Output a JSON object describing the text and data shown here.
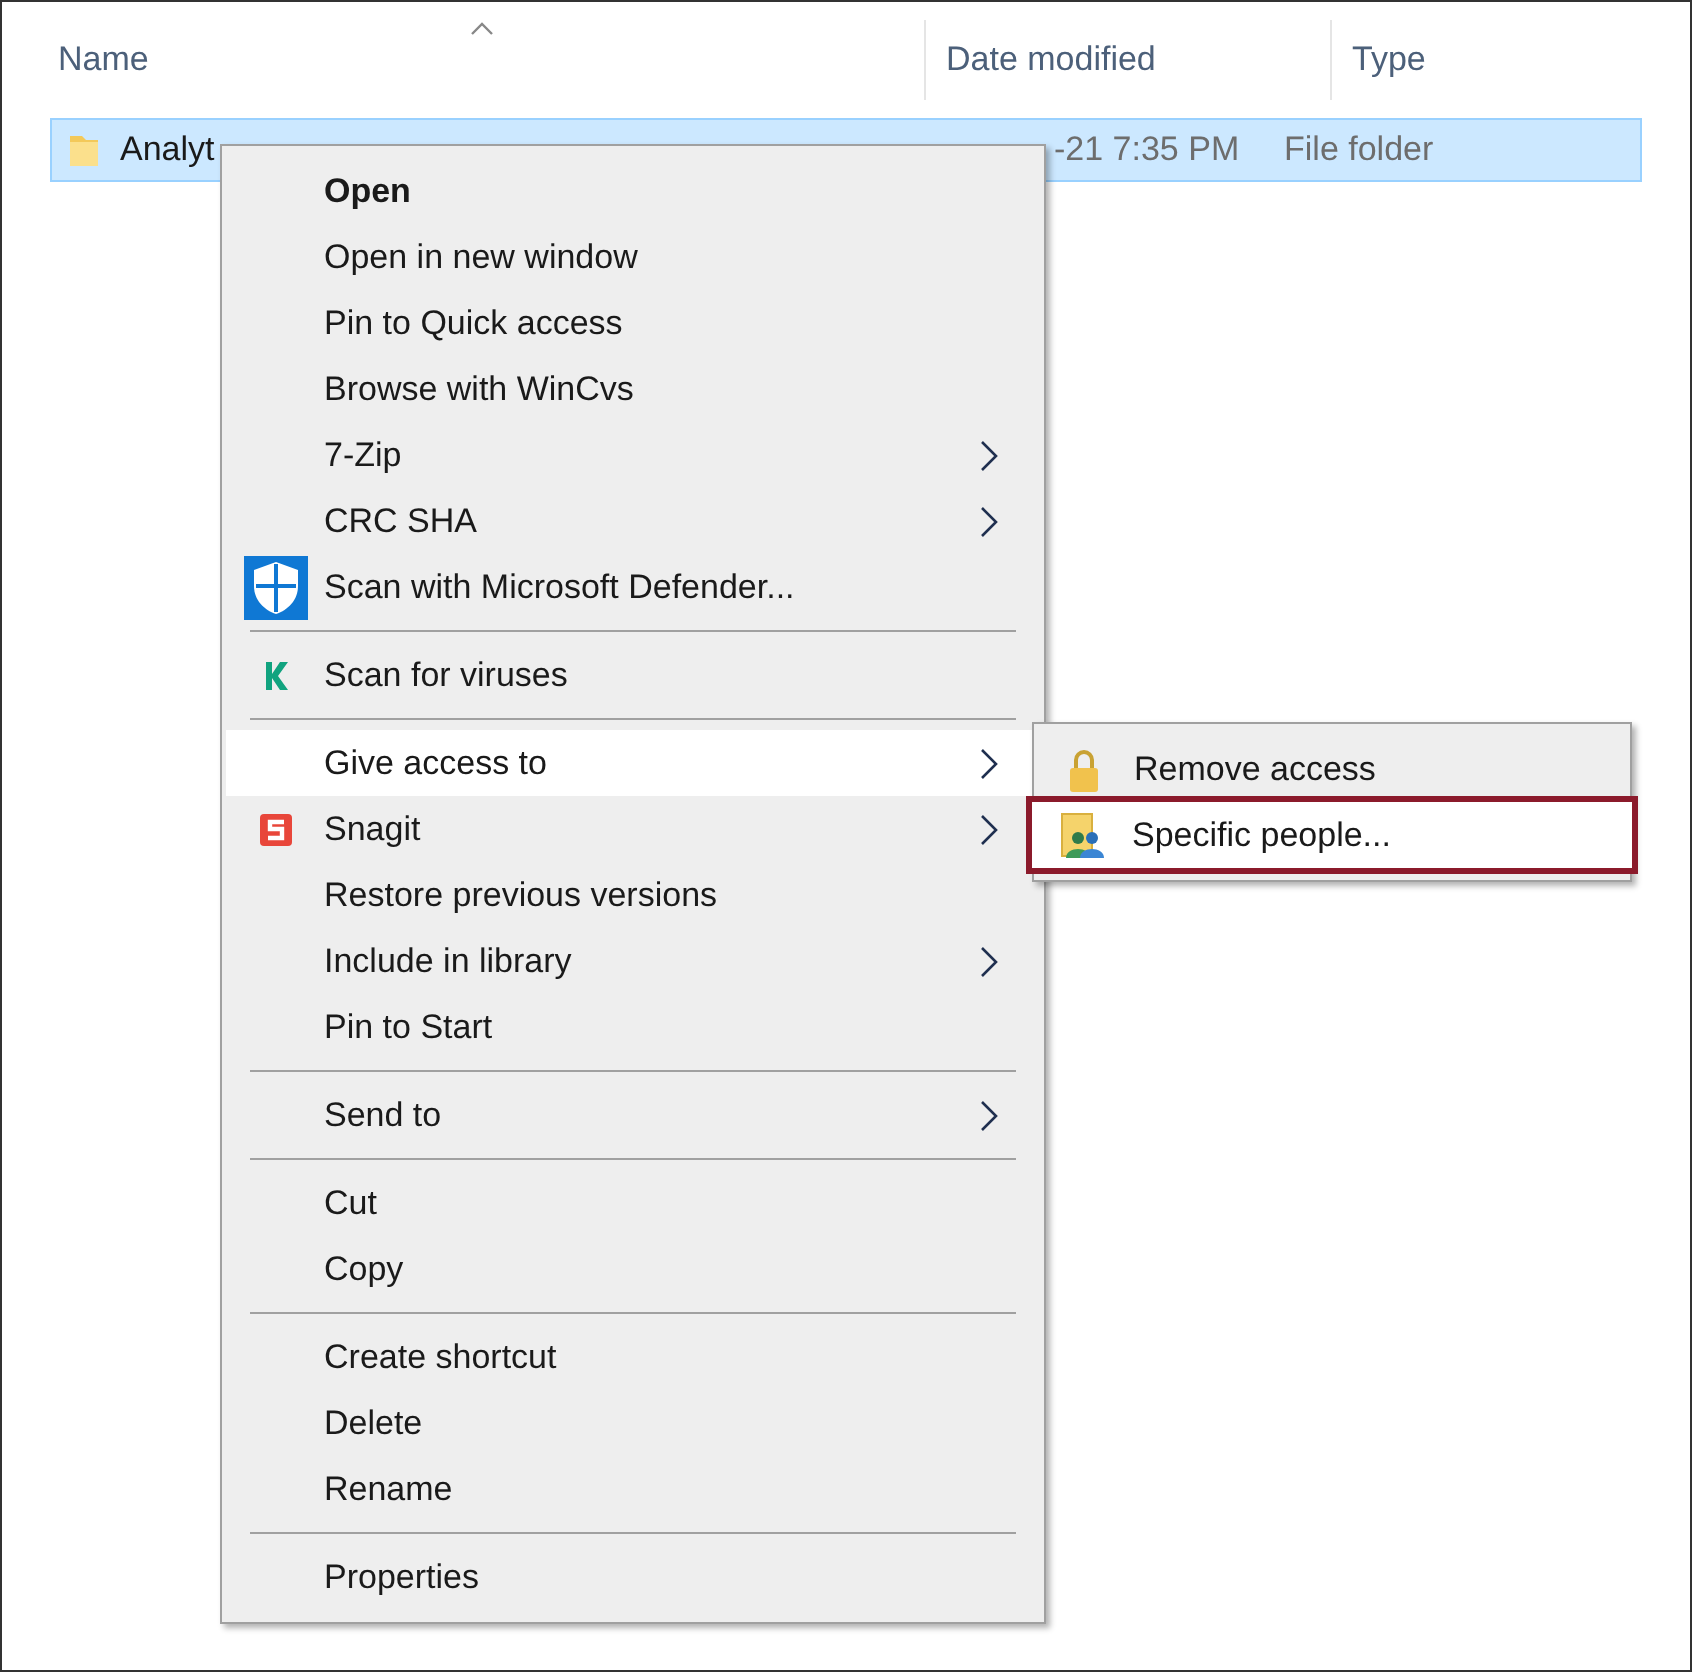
{
  "columns": [
    {
      "label": "Name"
    },
    {
      "label": "Date modified"
    },
    {
      "label": "Type"
    }
  ],
  "rows": [
    {
      "name": "Analyt",
      "date": "-21 7:35 PM",
      "type": "File folder",
      "selected": true
    }
  ],
  "context_menu": [
    {
      "kind": "item",
      "label": "Open",
      "bold": true,
      "submenu": false,
      "selected": false
    },
    {
      "kind": "item",
      "label": "Open in new window",
      "bold": false,
      "submenu": false,
      "selected": false
    },
    {
      "kind": "item",
      "label": "Pin to Quick access",
      "bold": false,
      "submenu": false,
      "selected": false
    },
    {
      "kind": "item",
      "label": "Browse with WinCvs",
      "bold": false,
      "submenu": false,
      "selected": false
    },
    {
      "kind": "item",
      "label": "7-Zip",
      "bold": false,
      "submenu": true,
      "selected": false
    },
    {
      "kind": "item",
      "label": "CRC SHA",
      "bold": false,
      "submenu": true,
      "selected": false
    },
    {
      "kind": "item",
      "label": "Scan with Microsoft Defender...",
      "bold": false,
      "submenu": false,
      "selected": false
    },
    {
      "kind": "separator"
    },
    {
      "kind": "item",
      "label": "Scan for viruses",
      "bold": false,
      "submenu": false,
      "selected": false
    },
    {
      "kind": "separator"
    },
    {
      "kind": "item",
      "label": "Give access to",
      "bold": false,
      "submenu": true,
      "selected": true
    },
    {
      "kind": "item",
      "label": "Snagit",
      "bold": false,
      "submenu": true,
      "selected": false
    },
    {
      "kind": "item",
      "label": "Restore previous versions",
      "bold": false,
      "submenu": false,
      "selected": false
    },
    {
      "kind": "item",
      "label": "Include in library",
      "bold": false,
      "submenu": true,
      "selected": false
    },
    {
      "kind": "item",
      "label": "Pin to Start",
      "bold": false,
      "submenu": false,
      "selected": false
    },
    {
      "kind": "separator"
    },
    {
      "kind": "item",
      "label": "Send to",
      "bold": false,
      "submenu": true,
      "selected": false
    },
    {
      "kind": "separator"
    },
    {
      "kind": "item",
      "label": "Cut",
      "bold": false,
      "submenu": false,
      "selected": false
    },
    {
      "kind": "item",
      "label": "Copy",
      "bold": false,
      "submenu": false,
      "selected": false
    },
    {
      "kind": "separator"
    },
    {
      "kind": "item",
      "label": "Create shortcut",
      "bold": false,
      "submenu": false,
      "selected": false
    },
    {
      "kind": "item",
      "label": "Delete",
      "bold": false,
      "submenu": false,
      "selected": false
    },
    {
      "kind": "item",
      "label": "Rename",
      "bold": false,
      "submenu": false,
      "selected": false
    },
    {
      "kind": "separator"
    },
    {
      "kind": "item",
      "label": "Properties",
      "bold": false,
      "submenu": false,
      "selected": false
    }
  ],
  "submenu": [
    {
      "label": "Remove access",
      "selected": false
    },
    {
      "label": "Specific people...",
      "selected": true
    }
  ]
}
